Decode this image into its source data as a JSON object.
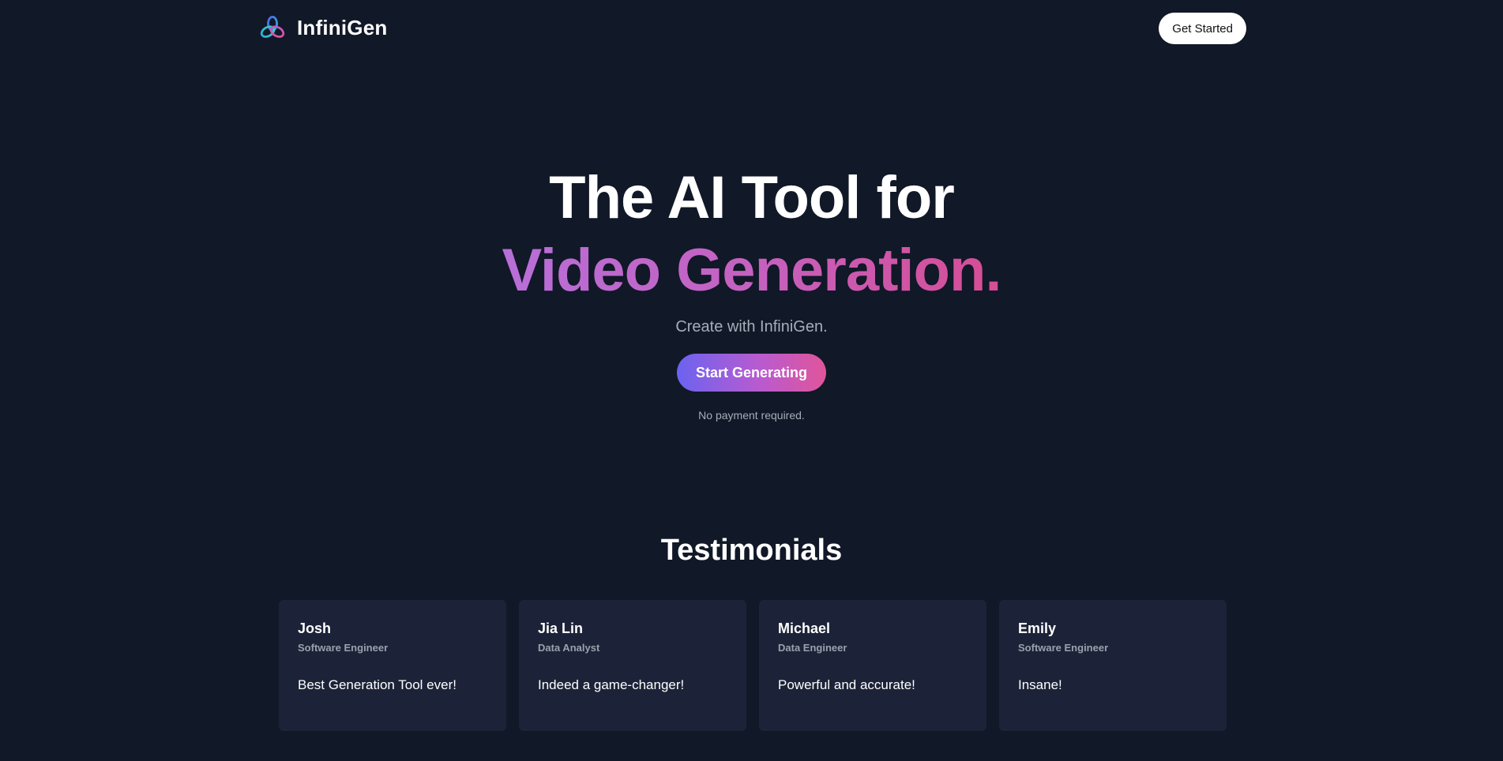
{
  "header": {
    "brand_name": "InfiniGen",
    "logo_icon": "triple-ring-logo-icon",
    "get_started_label": "Get Started"
  },
  "hero": {
    "title_line1": "The AI Tool for",
    "title_line2": "Video Generation.",
    "subtitle": "Create with InfiniGen.",
    "cta_label": "Start Generating",
    "note": "No payment required."
  },
  "testimonials": {
    "title": "Testimonials",
    "items": [
      {
        "name": "Josh",
        "role": "Software Engineer",
        "quote": "Best Generation Tool ever!"
      },
      {
        "name": "Jia Lin",
        "role": "Data Analyst",
        "quote": "Indeed a game-changer!"
      },
      {
        "name": "Michael",
        "role": "Data Engineer",
        "quote": "Powerful and accurate!"
      },
      {
        "name": "Emily",
        "role": "Software Engineer",
        "quote": "Insane!"
      }
    ]
  },
  "colors": {
    "background": "#111827",
    "card_background": "#1c2338",
    "gradient_start": "#6b63f0",
    "gradient_mid": "#b85bd0",
    "gradient_end": "#e0559a",
    "title_gradient_start": "#b76fd8",
    "title_gradient_end": "#d64d94",
    "muted_text": "#a7adb8"
  }
}
